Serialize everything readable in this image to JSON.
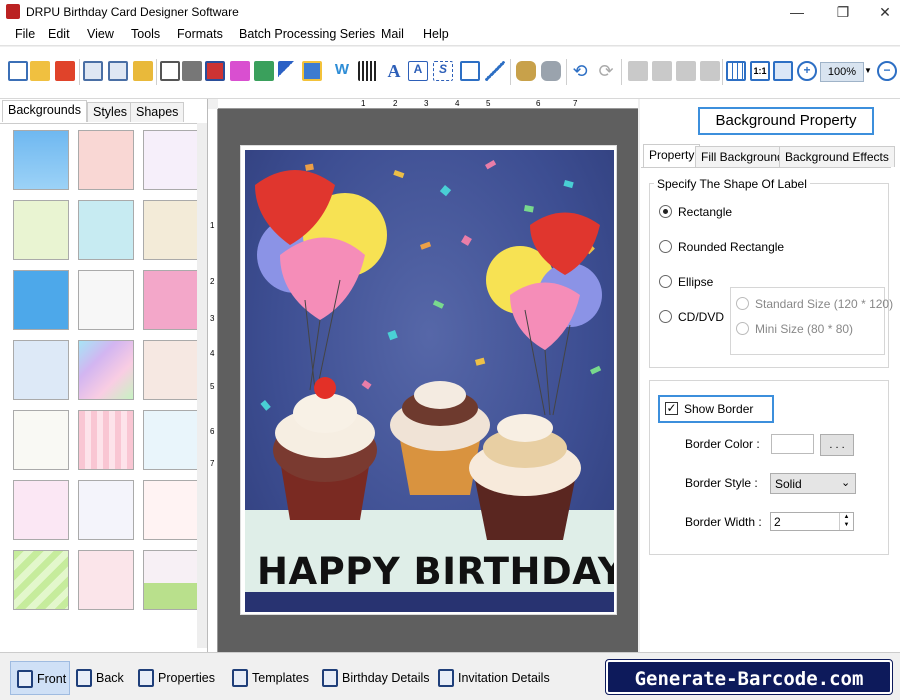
{
  "window": {
    "title": "DRPU Birthday Card Designer Software"
  },
  "menu": [
    "File",
    "Edit",
    "View",
    "Tools",
    "Formats",
    "Batch Processing Series",
    "Mail",
    "Help"
  ],
  "toolbar": {
    "zoom": "100%"
  },
  "left_panel": {
    "tabs": [
      "Backgrounds",
      "Styles",
      "Shapes"
    ],
    "active_tab": "Backgrounds"
  },
  "ruler": {
    "h_ticks": [
      "1",
      "2",
      "3",
      "4",
      "5",
      "6",
      "7"
    ],
    "v_ticks": [
      "1",
      "2",
      "3",
      "4",
      "5",
      "6",
      "7"
    ]
  },
  "card": {
    "greeting": "HAPPY BIRTHDAY"
  },
  "right_panel": {
    "header": "Background Property",
    "tabs": [
      "Property",
      "Fill Background",
      "Background Effects"
    ],
    "shape_group": {
      "legend": "Specify The Shape Of Label",
      "options": [
        "Rectangle",
        "Rounded Rectangle",
        "Ellipse",
        "CD/DVD"
      ],
      "selected": "Rectangle",
      "cd_options": [
        "Standard Size (120 * 120)",
        "Mini Size (80 * 80)"
      ]
    },
    "border": {
      "show_border_label": "Show Border",
      "show_border": true,
      "color_label": "Border Color :",
      "color_button": ". . .",
      "style_label": "Border Style :",
      "style_value": "Solid",
      "width_label": "Border Width :",
      "width_value": "2"
    }
  },
  "bottom_bar": [
    "Front",
    "Back",
    "Properties",
    "Templates",
    "Birthday Details",
    "Invitation Details"
  ],
  "brand": "Generate-Barcode.com"
}
